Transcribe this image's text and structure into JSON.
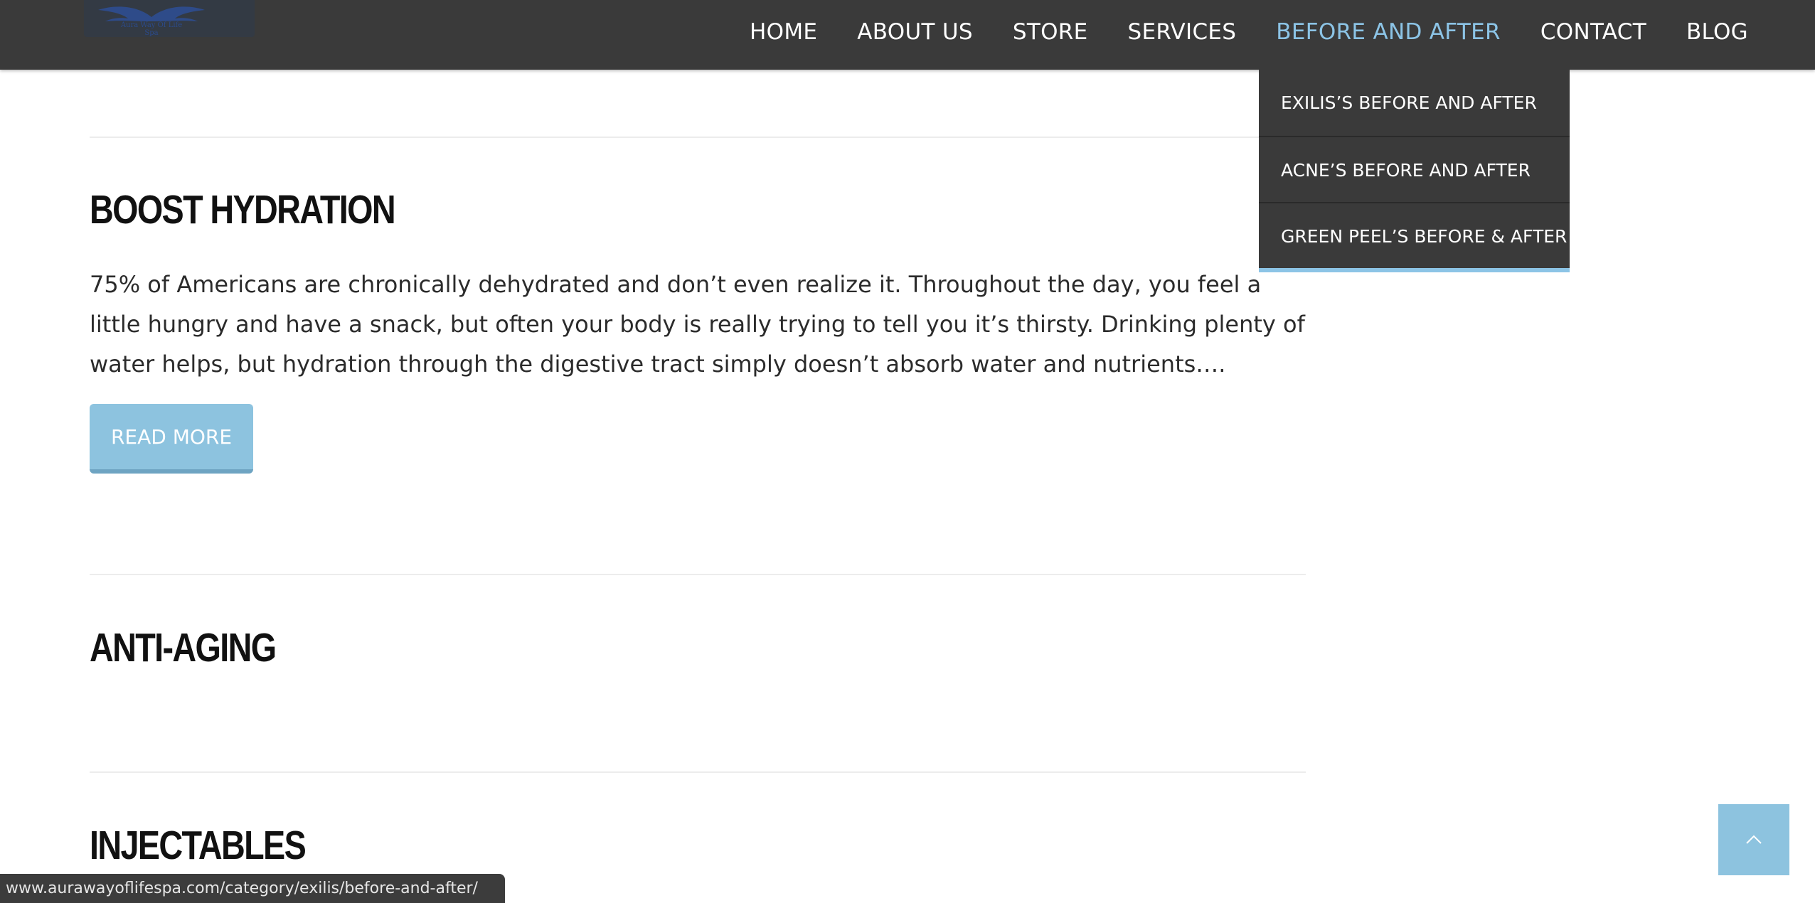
{
  "brand": {
    "logo_text_line1": "Aura Way Of Life",
    "logo_text_line2": "Spa"
  },
  "nav": {
    "items": [
      {
        "label": "HOME"
      },
      {
        "label": "ABOUT US"
      },
      {
        "label": "STORE"
      },
      {
        "label": "SERVICES"
      },
      {
        "label": "BEFORE AND AFTER",
        "active": true
      },
      {
        "label": "CONTACT"
      },
      {
        "label": "BLOG"
      }
    ],
    "active_color": "#8cc4e6"
  },
  "dropdown": {
    "items": [
      {
        "label": "EXILIS’S BEFORE AND AFTER"
      },
      {
        "label": "ACNE’S BEFORE AND AFTER"
      },
      {
        "label": "GREEN PEEL’S BEFORE & AFTER"
      }
    ]
  },
  "posts": [
    {
      "title": "BOOST HYDRATION",
      "excerpt": "75% of Americans are chronically dehydrated and don’t even realize it. Throughout the day, you feel a little hungry and have a snack, but often your body is really trying to tell you it’s thirsty. Drinking plenty of water helps, but hydration through the digestive tract simply doesn’t absorb water and nutrients….",
      "read_more": "READ MORE"
    },
    {
      "title": "ANTI-AGING"
    },
    {
      "title": "INJECTABLES"
    }
  ],
  "status_url": "www.aurawayoflifespa.com/category/exilis/before-and-after/",
  "colors": {
    "navbar": "#3a3a3a",
    "accent": "#8dc3df"
  },
  "icons": {
    "back_to_top": "chevron-up-icon"
  }
}
